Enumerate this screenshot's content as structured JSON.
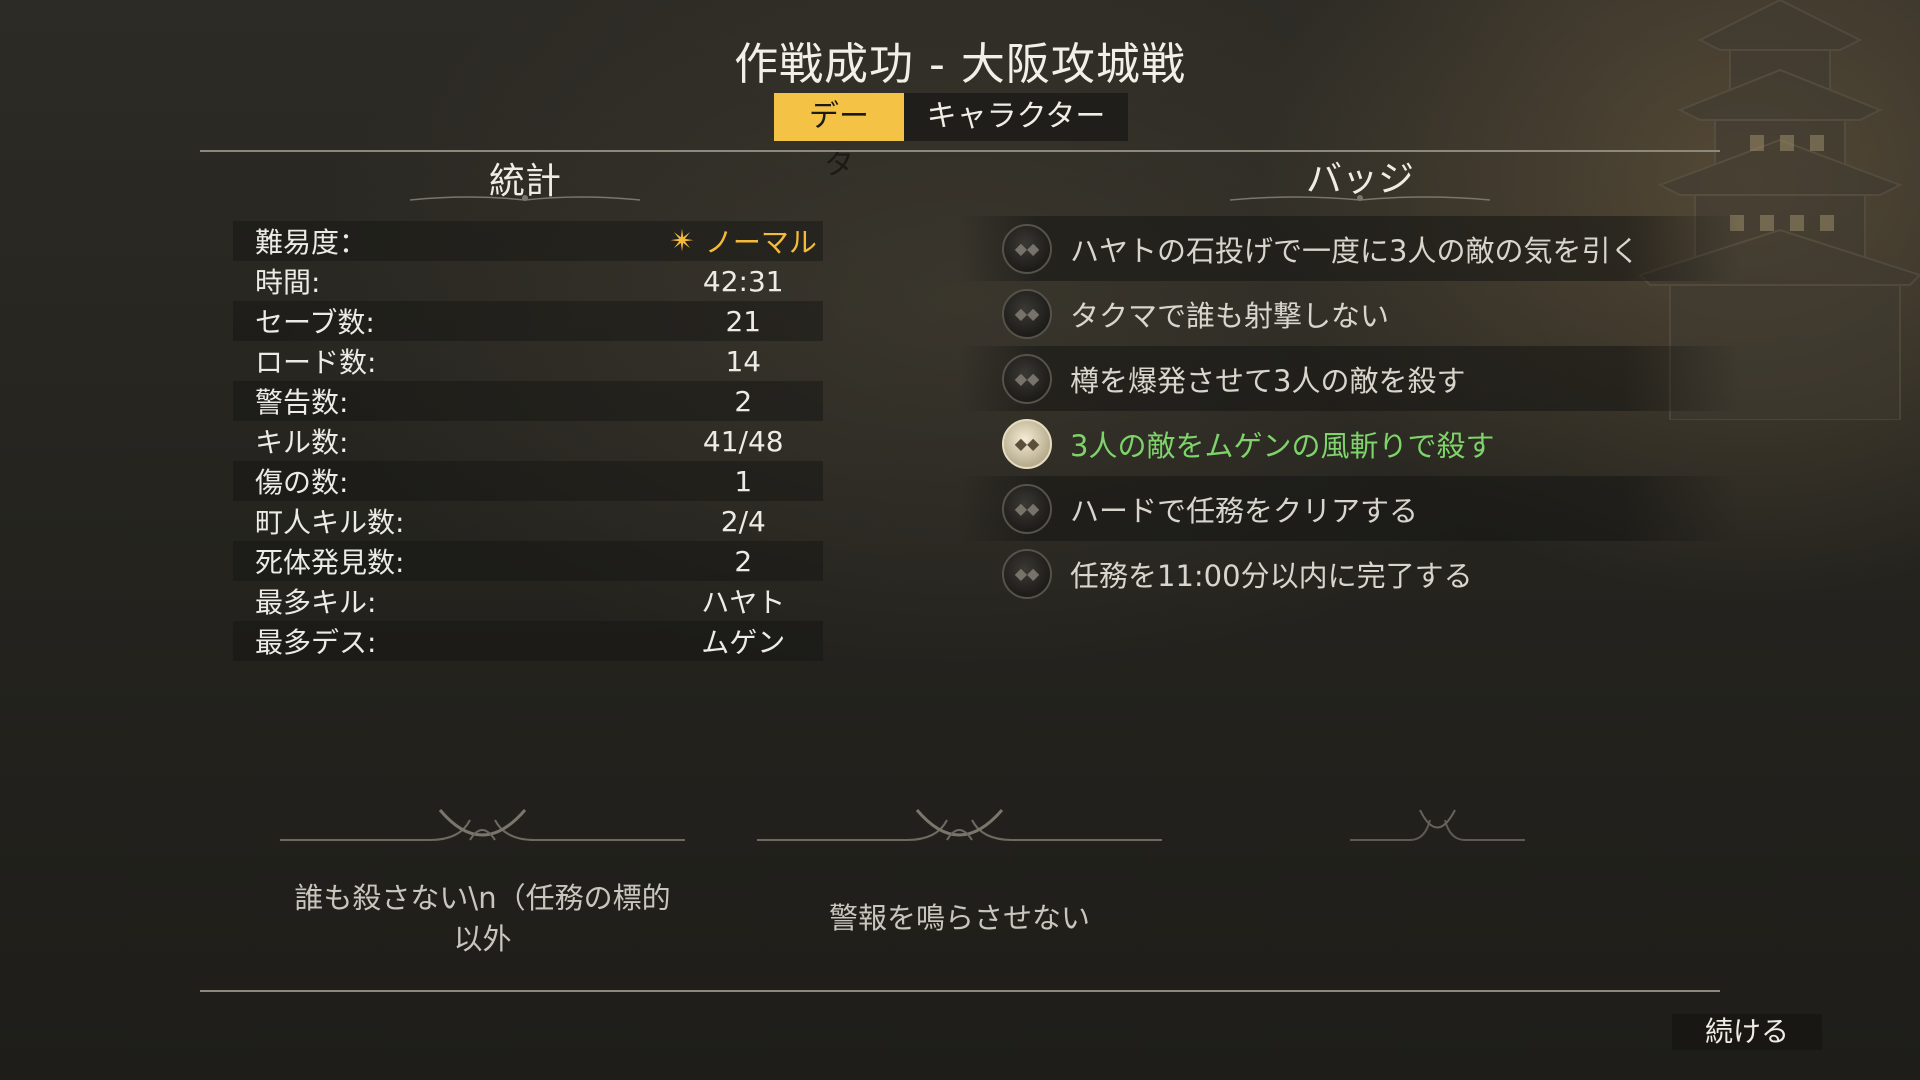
{
  "title": "作戦成功 - 大阪攻城戦",
  "tabs": [
    {
      "label": "データ",
      "active": true
    },
    {
      "label": "キャラクター",
      "active": false
    }
  ],
  "stats": {
    "title": "統計",
    "difficulty": {
      "label": "難易度：",
      "value": "ノーマル",
      "icon": "shuriken-icon"
    },
    "rows": [
      {
        "label": "時間:",
        "value": "42:31"
      },
      {
        "label": "セーブ数:",
        "value": "21"
      },
      {
        "label": "ロード数:",
        "value": "14"
      },
      {
        "label": "警告数:",
        "value": "2"
      },
      {
        "label": "キル数:",
        "value": "41/48"
      },
      {
        "label": "傷の数:",
        "value": "1"
      },
      {
        "label": "町人キル数:",
        "value": "2/4"
      },
      {
        "label": "死体発見数:",
        "value": "2"
      },
      {
        "label": "最多キル:",
        "value": "ハヤト"
      },
      {
        "label": "最多デス:",
        "value": "ムゲン"
      }
    ]
  },
  "badges": {
    "title": "バッジ",
    "items": [
      {
        "text": "ハヤトの石投げで一度に3人の敵の気を引く",
        "achieved": false
      },
      {
        "text": "タクマで誰も射撃しない",
        "achieved": false
      },
      {
        "text": "樽を爆発させて3人の敵を殺す",
        "achieved": false
      },
      {
        "text": "3人の敵をムゲンの風斬りで殺す",
        "achieved": true
      },
      {
        "text": "ハードで任務をクリアする",
        "achieved": false
      },
      {
        "text": "任務を11:00分以内に完了する",
        "achieved": false
      }
    ]
  },
  "challenges": [
    {
      "line1": "誰も殺さない\\n（任務の標的",
      "line2": "以外"
    },
    {
      "line1": "警報を鳴らさせない",
      "line2": ""
    }
  ],
  "continue_label": "続ける",
  "colors": {
    "accent": "#f4c346",
    "achieved": "#7ed36a",
    "difficulty": "#f4bb3a"
  }
}
